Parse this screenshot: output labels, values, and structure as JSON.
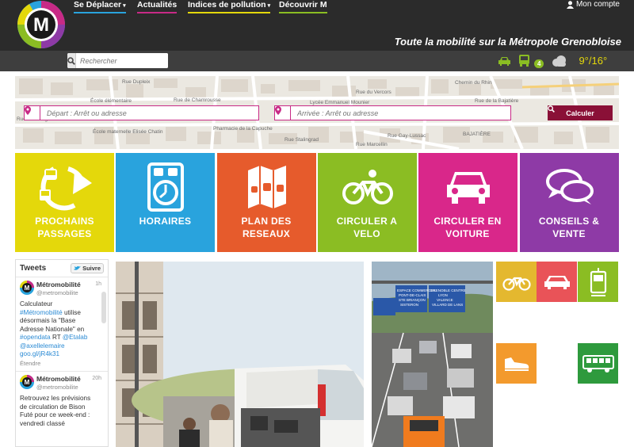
{
  "header": {
    "logo_letter": "M",
    "nav": [
      {
        "label": "Se Déplacer",
        "caret": "▾",
        "color": "#29a3dd"
      },
      {
        "label": "Actualités",
        "caret": "",
        "color": "#c82a86"
      },
      {
        "label": "Indices de pollution",
        "caret": "▾",
        "color": "#e4d80b"
      },
      {
        "label": "Découvrir M",
        "caret": "",
        "color": "#8bbd23"
      }
    ],
    "account": "Mon compte",
    "tagline": "Toute la mobilité sur la Métropole Grenobloise"
  },
  "search": {
    "placeholder": "Rechercher"
  },
  "status": {
    "badge": "4",
    "weather": "9°/16°"
  },
  "map": {
    "depart_placeholder": "Départ : Arrêt ou adresse",
    "arrivee_placeholder": "Arrivée : Arrêt ou adresse",
    "calc_label": "Calculer",
    "labels": [
      "Rue Dupleix",
      "Rue de Chamrousse",
      "École élémentaire",
      "Lycée Emmanuel Mounier",
      "Rue du Vercors",
      "Chemin du Rhin",
      "Rue de la Bajatière",
      "Rue Gay-Lussac",
      "BAJATIÈRE",
      "Pharmacie de la Capuche",
      "École maternelle Elisée Chatin",
      "Rue Stalingrad",
      "Rue de Mangin",
      "Rue Marcellin"
    ]
  },
  "tiles": [
    {
      "label": "PROCHAINS PASSAGES",
      "color": "#e4d80b"
    },
    {
      "label": "HORAIRES",
      "color": "#29a3dd"
    },
    {
      "label": "PLAN DES RESEAUX",
      "color": "#e65b2c"
    },
    {
      "label": "CIRCULER A VELO",
      "color": "#8bbd23"
    },
    {
      "label": "CIRCULER EN VOITURE",
      "color": "#d9278a"
    },
    {
      "label": "CONSEILS & VENTE",
      "color": "#8e3aa6"
    }
  ],
  "tweets": {
    "title": "Tweets",
    "follow": "Suivre",
    "items": [
      {
        "name": "Métromobilité",
        "handle": "@metromobilite",
        "time": "1h",
        "text_a": "Calculateur ",
        "hashtag1": "#Métromobilité",
        "text_b": " utilise désormais la \"Base Adresse Nationale\" en ",
        "hashtag2": "#opendata",
        "text_c": " RT ",
        "mention1": "@Etalab",
        "mention2": "@axellelemaire",
        "link": "goo.gl/jR4k31",
        "expand": "Étendre"
      },
      {
        "name": "Métromobilité",
        "handle": "@metromobilite",
        "time": "20h",
        "text": "Retrouvez les prévisions de circulation de Bison Futé pour ce week-end : vendredi classé"
      }
    ]
  },
  "road_signs": {
    "sign1": "ESPACE COMMERCIAL\nPONT-DE-CLAIX\nSTE BRIANÇON\nSISTERON",
    "sign2": "GRENOBLE CENTRE\nLYON\nVALENCE\nVILLARD DE LANS"
  }
}
